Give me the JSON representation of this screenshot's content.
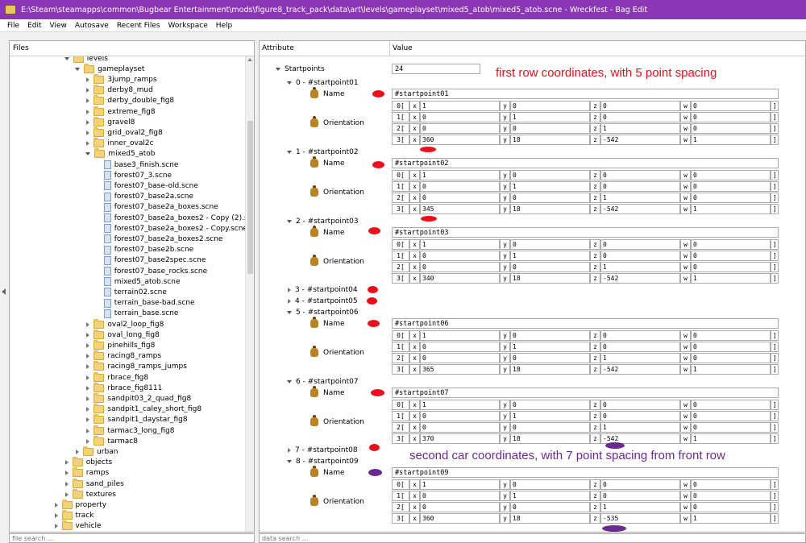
{
  "window": {
    "title": "E:\\Steam\\steamapps\\common\\Bugbear Entertainment\\mods\\figure8_track_pack\\data\\art\\levels\\gameplayset\\mixed5_atob\\mixed5_atob.scne - Wreckfest - Bag Edit"
  },
  "menu": [
    "File",
    "Edit",
    "View",
    "Autosave",
    "Recent Files",
    "Workspace",
    "Help"
  ],
  "files_pane": {
    "header": "Files",
    "search_placeholder": "file search ...",
    "tree": [
      {
        "label": "levels",
        "indent": 6,
        "type": "folder",
        "exp": "open"
      },
      {
        "label": "gameplayset",
        "indent": 7,
        "type": "folder",
        "exp": "open"
      },
      {
        "label": "3jump_ramps",
        "indent": 8,
        "type": "folder",
        "exp": "closed"
      },
      {
        "label": "derby8_mud",
        "indent": 8,
        "type": "folder",
        "exp": "closed"
      },
      {
        "label": "derby_double_fig8",
        "indent": 8,
        "type": "folder",
        "exp": "closed"
      },
      {
        "label": "extreme_fig8",
        "indent": 8,
        "type": "folder",
        "exp": "closed"
      },
      {
        "label": "gravel8",
        "indent": 8,
        "type": "folder",
        "exp": "closed"
      },
      {
        "label": "grid_oval2_fig8",
        "indent": 8,
        "type": "folder",
        "exp": "closed"
      },
      {
        "label": "inner_oval2c",
        "indent": 8,
        "type": "folder",
        "exp": "closed"
      },
      {
        "label": "mixed5_atob",
        "indent": 8,
        "type": "folder",
        "exp": "open"
      },
      {
        "label": "base3_finish.scne",
        "indent": 9,
        "type": "file",
        "exp": "none"
      },
      {
        "label": "forest07_3.scne",
        "indent": 9,
        "type": "file",
        "exp": "none"
      },
      {
        "label": "forest07_base-old.scne",
        "indent": 9,
        "type": "file",
        "exp": "none"
      },
      {
        "label": "forest07_base2a.scne",
        "indent": 9,
        "type": "file",
        "exp": "none"
      },
      {
        "label": "forest07_base2a_boxes.scne",
        "indent": 9,
        "type": "file",
        "exp": "none"
      },
      {
        "label": "forest07_base2a_boxes2 - Copy (2).scne",
        "indent": 9,
        "type": "file",
        "exp": "none"
      },
      {
        "label": "forest07_base2a_boxes2 - Copy.scne",
        "indent": 9,
        "type": "file",
        "exp": "none"
      },
      {
        "label": "forest07_base2a_boxes2.scne",
        "indent": 9,
        "type": "file",
        "exp": "none"
      },
      {
        "label": "forest07_base2b.scne",
        "indent": 9,
        "type": "file",
        "exp": "none"
      },
      {
        "label": "forest07_base2spec.scne",
        "indent": 9,
        "type": "file",
        "exp": "none"
      },
      {
        "label": "forest07_base_rocks.scne",
        "indent": 9,
        "type": "file",
        "exp": "none"
      },
      {
        "label": "mixed5_atob.scne",
        "indent": 9,
        "type": "file",
        "exp": "none"
      },
      {
        "label": "terrain02.scne",
        "indent": 9,
        "type": "file",
        "exp": "none"
      },
      {
        "label": "terrain_base-bad.scne",
        "indent": 9,
        "type": "file",
        "exp": "none"
      },
      {
        "label": "terrain_base.scne",
        "indent": 9,
        "type": "file",
        "exp": "none"
      },
      {
        "label": "oval2_loop_fig8",
        "indent": 8,
        "type": "folder",
        "exp": "closed"
      },
      {
        "label": "oval_long_fig8",
        "indent": 8,
        "type": "folder",
        "exp": "closed"
      },
      {
        "label": "pinehills_fig8",
        "indent": 8,
        "type": "folder",
        "exp": "closed"
      },
      {
        "label": "racing8_ramps",
        "indent": 8,
        "type": "folder",
        "exp": "closed"
      },
      {
        "label": "racing8_ramps_jumps",
        "indent": 8,
        "type": "folder",
        "exp": "closed"
      },
      {
        "label": "rbrace_fig8",
        "indent": 8,
        "type": "folder",
        "exp": "closed"
      },
      {
        "label": "rbrace_fig8111",
        "indent": 8,
        "type": "folder",
        "exp": "closed"
      },
      {
        "label": "sandpit03_2_quad_fig8",
        "indent": 8,
        "type": "folder",
        "exp": "closed"
      },
      {
        "label": "sandpit1_caley_short_fig8",
        "indent": 8,
        "type": "folder",
        "exp": "closed"
      },
      {
        "label": "sandpit1_daystar_fig8",
        "indent": 8,
        "type": "folder",
        "exp": "closed"
      },
      {
        "label": "tarmac3_long_fig8",
        "indent": 8,
        "type": "folder",
        "exp": "closed"
      },
      {
        "label": "tarmac8",
        "indent": 8,
        "type": "folder",
        "exp": "closed"
      },
      {
        "label": "urban",
        "indent": 7,
        "type": "folder",
        "exp": "closed"
      },
      {
        "label": "objects",
        "indent": 6,
        "type": "folder",
        "exp": "closed"
      },
      {
        "label": "ramps",
        "indent": 6,
        "type": "folder",
        "exp": "closed"
      },
      {
        "label": "sand_piles",
        "indent": 6,
        "type": "folder",
        "exp": "closed"
      },
      {
        "label": "textures",
        "indent": 6,
        "type": "folder",
        "exp": "closed"
      },
      {
        "label": "property",
        "indent": 5,
        "type": "folder",
        "exp": "closed"
      },
      {
        "label": "track",
        "indent": 5,
        "type": "folder",
        "exp": "closed"
      },
      {
        "label": "vehicle",
        "indent": 5,
        "type": "folder",
        "exp": "closed"
      }
    ]
  },
  "attr_pane": {
    "col_attribute": "Attribute",
    "col_value": "Value",
    "search_placeholder": "data search ...",
    "startpoints_label": "Startpoints",
    "startpoints_count": "24",
    "name_label": "Name",
    "orientation_label": "Orientation",
    "expanded_points": [
      {
        "label": "0 - #startpoint01",
        "name": "#startpoint01",
        "r3": [
          "360",
          "18",
          "-542",
          "1"
        ]
      },
      {
        "label": "1 - #startpoint02",
        "name": "#startpoint02",
        "r3": [
          "345",
          "18",
          "-542",
          "1"
        ]
      },
      {
        "label": "2 - #startpoint03",
        "name": "#startpoint03",
        "r3": [
          "340",
          "18",
          "-542",
          "1"
        ]
      },
      {
        "label": "5 - #startpoint06",
        "name": "#startpoint06",
        "r3": [
          "365",
          "18",
          "-542",
          "1"
        ]
      },
      {
        "label": "6 - #startpoint07",
        "name": "#startpoint07",
        "r3": [
          "370",
          "18",
          "-542",
          "1"
        ]
      },
      {
        "label": "8 - #startpoint09",
        "name": "#startpoint09",
        "r3": [
          "360",
          "18",
          "-535",
          "1"
        ]
      }
    ],
    "collapsed_points": [
      "3 - #startpoint04",
      "4 - #startpoint05",
      "7 - #startpoint08"
    ],
    "matrix_rows": [
      [
        "1",
        "0",
        "0",
        "0"
      ],
      [
        "0",
        "1",
        "0",
        "0"
      ],
      [
        "0",
        "0",
        "1",
        "0"
      ]
    ],
    "row_prefixes": [
      "0[",
      "1[",
      "2[",
      "3["
    ],
    "axis_labels": [
      "x",
      "y",
      "z",
      "w"
    ],
    "row_suffix": "]"
  },
  "annotations": {
    "first_row_note": "first row coordinates, with 5 point spacing",
    "second_row_note": "second car coordinates, with 7 point spacing from front row",
    "first_row_color": "#e8101a",
    "second_row_color": "#6a2a8f"
  },
  "colors": {
    "titlebar": "#8a36b5"
  }
}
